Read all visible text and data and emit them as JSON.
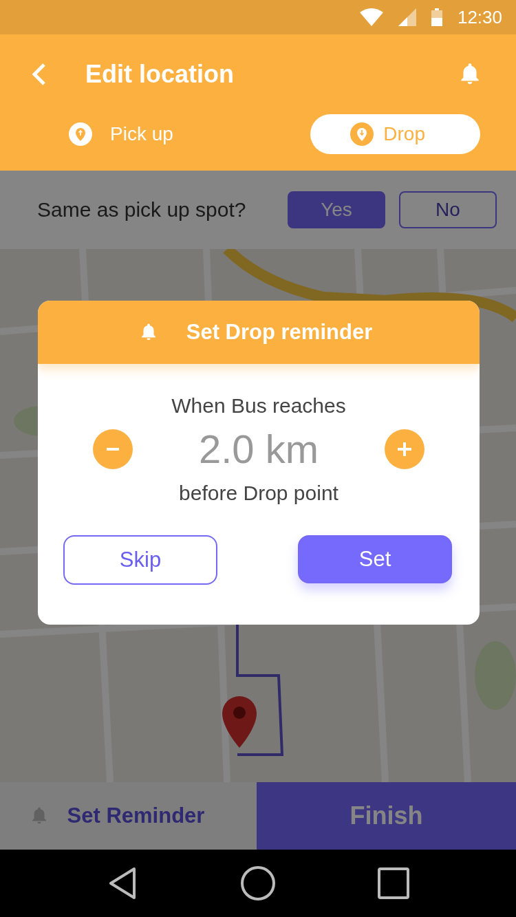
{
  "status_bar": {
    "time": "12:30"
  },
  "header": {
    "title": "Edit location"
  },
  "tabs": [
    {
      "label": "Pick up",
      "selected": false
    },
    {
      "label": "Drop",
      "selected": true
    }
  ],
  "question": {
    "text": "Same as pick up spot?",
    "options": [
      {
        "label": "Yes",
        "selected": true
      },
      {
        "label": "No",
        "selected": false
      }
    ]
  },
  "dialog": {
    "title": "Set Drop reminder",
    "line_1": "When Bus reaches",
    "value": "2.0 km",
    "line_2": "before Drop point",
    "buttons": [
      {
        "label": "Skip",
        "kind": "outline"
      },
      {
        "label": "Set",
        "kind": "filled"
      }
    ]
  },
  "bottom_bar": {
    "reminder": "Set Reminder",
    "finish": "Finish"
  }
}
